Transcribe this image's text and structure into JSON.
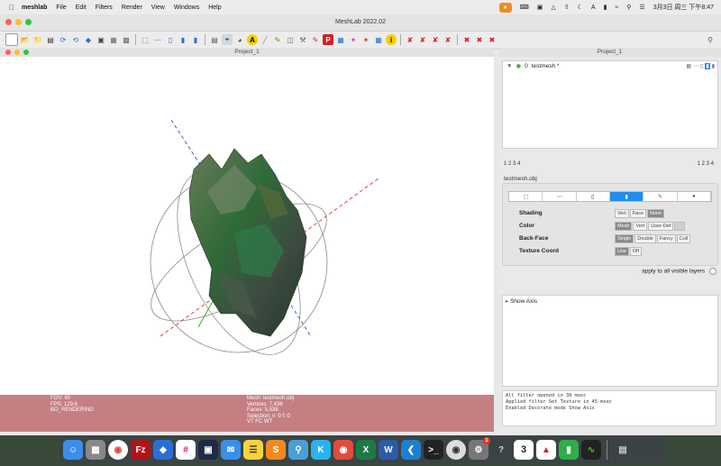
{
  "menubar": {
    "app": "meshlab",
    "items": [
      "File",
      "Edit",
      "Filters",
      "Render",
      "View",
      "Windows",
      "Help"
    ],
    "clock": "3月3日 周三 下午8:47",
    "input_source": "A"
  },
  "window": {
    "title": "MeshLab 2022.02"
  },
  "project": {
    "panel_title": "Project_1"
  },
  "side": {
    "panel_title": "Project_1",
    "layer": {
      "index": "0",
      "name": "testmesh *"
    },
    "nums_left": "1  2  3  4",
    "nums_right": "1  2  3  4",
    "props_title": "testmesh.obj",
    "shading": {
      "label": "Shading",
      "options": [
        "Vert",
        "Face",
        "None"
      ],
      "active": 2
    },
    "color": {
      "label": "Color",
      "options": [
        "Mesh",
        "Vert",
        "User-Def"
      ],
      "active": 0
    },
    "backface": {
      "label": "Back-Face",
      "options": [
        "Single",
        "Double",
        "Fancy",
        "Cull"
      ],
      "active": 0
    },
    "texcoord": {
      "label": "Texture Coord",
      "options": [
        "Use",
        "Off"
      ],
      "active": 0
    },
    "apply_label": "apply to all visible layers",
    "filter_item": "Show Axis",
    "log": [
      "All filter opened in 39 msec",
      "Applied filter Set Texture in 45 msec",
      "Enabled Decorate mode Show Axis"
    ]
  },
  "info": {
    "left": [
      "FOV: 60",
      "FPS:   129.6",
      "BO_RENDERING"
    ],
    "right": [
      "Mesh: testmesh.obj",
      "Vertices: 7,436",
      "Faces: 5,538",
      "Selection: v: 0 f: 0",
      "VT FC WT"
    ]
  },
  "colors": {
    "info_bar": "#c57f82",
    "active_tab": "#1e8ff0",
    "axis_x": "#e03030",
    "axis_y": "#30b030",
    "axis_z": "#3050d0"
  },
  "dock": {
    "icons": [
      "finder-icon",
      "launchpad-icon",
      "chrome-icon",
      "filezilla-icon",
      "security-icon",
      "slack-icon",
      "zoom-icon",
      "mail-icon",
      "notes-icon",
      "sublime-icon",
      "search-icon",
      "kode-icon",
      "pdf-icon",
      "excel-icon",
      "word-icon",
      "vscode-icon",
      "terminal-icon",
      "meshlab-icon",
      "settings-icon",
      "help-icon",
      "calendar-icon",
      "acrobat-icon",
      "numbers-icon",
      "activity-icon",
      "trash-icon"
    ],
    "calendar_day": "3",
    "settings_badge": "1"
  }
}
